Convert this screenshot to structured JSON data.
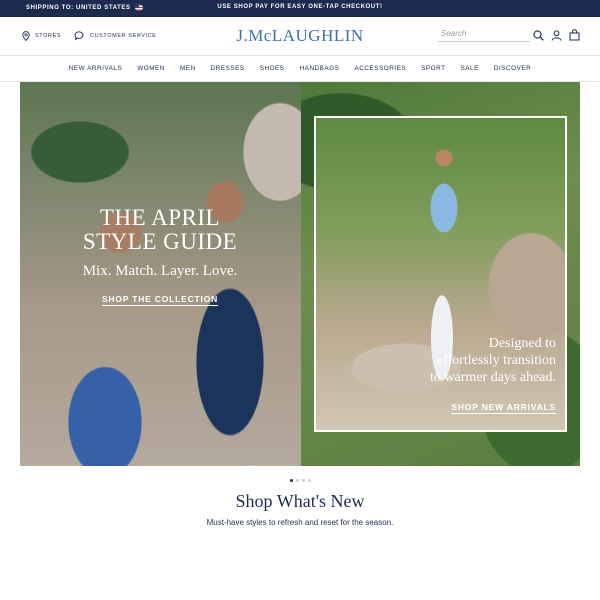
{
  "announcement": {
    "shipping": "SHIPPING TO: UNITED STATES",
    "promo": "USE SHOP PAY FOR EASY ONE-TAP CHECKOUT!"
  },
  "header": {
    "stores": "STORES",
    "customer_service": "CUSTOMER SERVICE",
    "logo": "J.McLAUGHLIN",
    "search_placeholder": "Search"
  },
  "nav": [
    "NEW ARRIVALS",
    "WOMEN",
    "MEN",
    "DRESSES",
    "SHOES",
    "HANDBAGS",
    "ACCESSORIES",
    "SPORT",
    "SALE",
    "DISCOVER"
  ],
  "hero": {
    "title_line1": "THE APRIL",
    "title_line2": "STYLE GUIDE",
    "subtitle": "Mix. Match. Layer. Love.",
    "cta_left": "SHOP THE COLLECTION",
    "right_line1": "Designed to",
    "right_line2": "effortlessly transition",
    "right_line3": "to warmer days ahead.",
    "cta_right": "SHOP NEW ARRIVALS"
  },
  "carousel": {
    "total": 4,
    "active": 1
  },
  "section": {
    "title": "Shop What's New",
    "subtitle": "Must-have styles to refresh and reset for the season."
  },
  "colors": {
    "navy": "#1c2a4e",
    "logo_blue": "#3a6fb7"
  }
}
